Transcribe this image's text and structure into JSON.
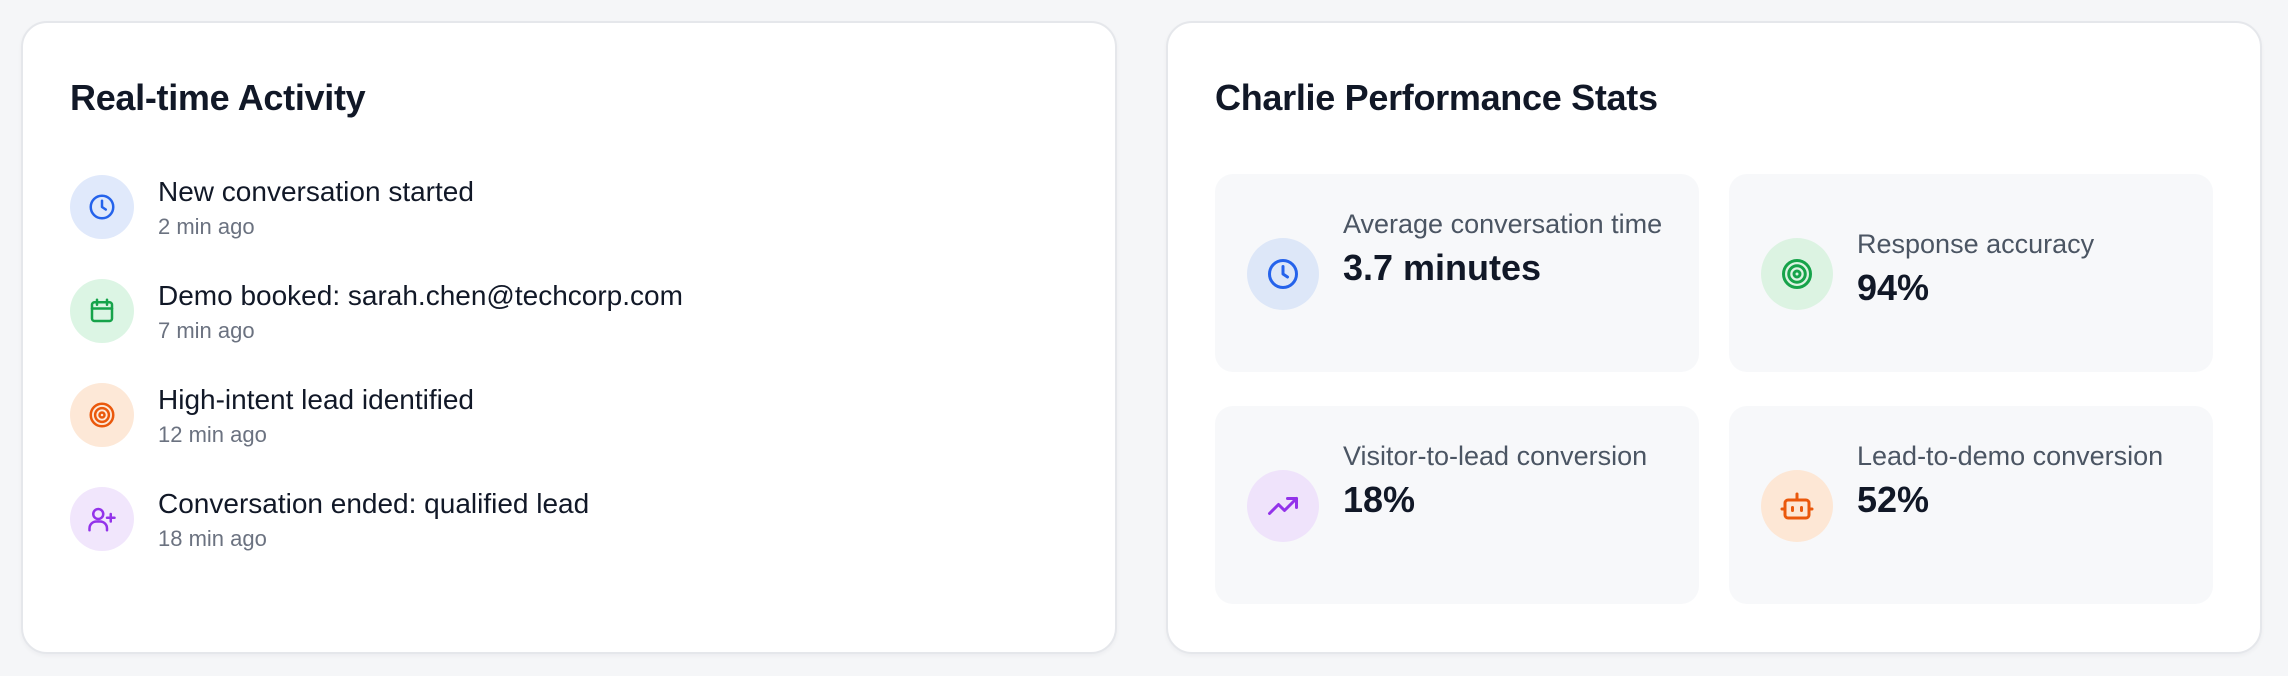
{
  "activity": {
    "title": "Real-time Activity",
    "items": [
      {
        "title": "New conversation started",
        "time": "2 min ago",
        "icon": "clock-icon",
        "color": "#2563eb",
        "bg": "#e0e9fb"
      },
      {
        "title": "Demo booked: sarah.chen@techcorp.com",
        "time": "7 min ago",
        "icon": "calendar-icon",
        "color": "#16a34a",
        "bg": "#dcf5e4"
      },
      {
        "title": "High-intent lead identified",
        "time": "12 min ago",
        "icon": "target-icon",
        "color": "#ea580c",
        "bg": "#fde8d7"
      },
      {
        "title": "Conversation ended: qualified lead",
        "time": "18 min ago",
        "icon": "user-plus-icon",
        "color": "#9333ea",
        "bg": "#f1e6fc"
      }
    ]
  },
  "stats": {
    "title": "Charlie Performance Stats",
    "items": [
      {
        "label": "Average conversation time",
        "value": "3.7 minutes",
        "icon": "clock-icon",
        "color": "#2563eb",
        "bg": "#dde7f8"
      },
      {
        "label": "Response accuracy",
        "value": "94%",
        "icon": "target-icon",
        "color": "#16a34a",
        "bg": "#dcf3e2"
      },
      {
        "label": "Visitor-to-lead conversion",
        "value": "18%",
        "icon": "trending-up-icon",
        "color": "#9333ea",
        "bg": "#efe3fb"
      },
      {
        "label": "Lead-to-demo conversion",
        "value": "52%",
        "icon": "bot-icon",
        "color": "#ea580c",
        "bg": "#fde7d5"
      }
    ]
  }
}
